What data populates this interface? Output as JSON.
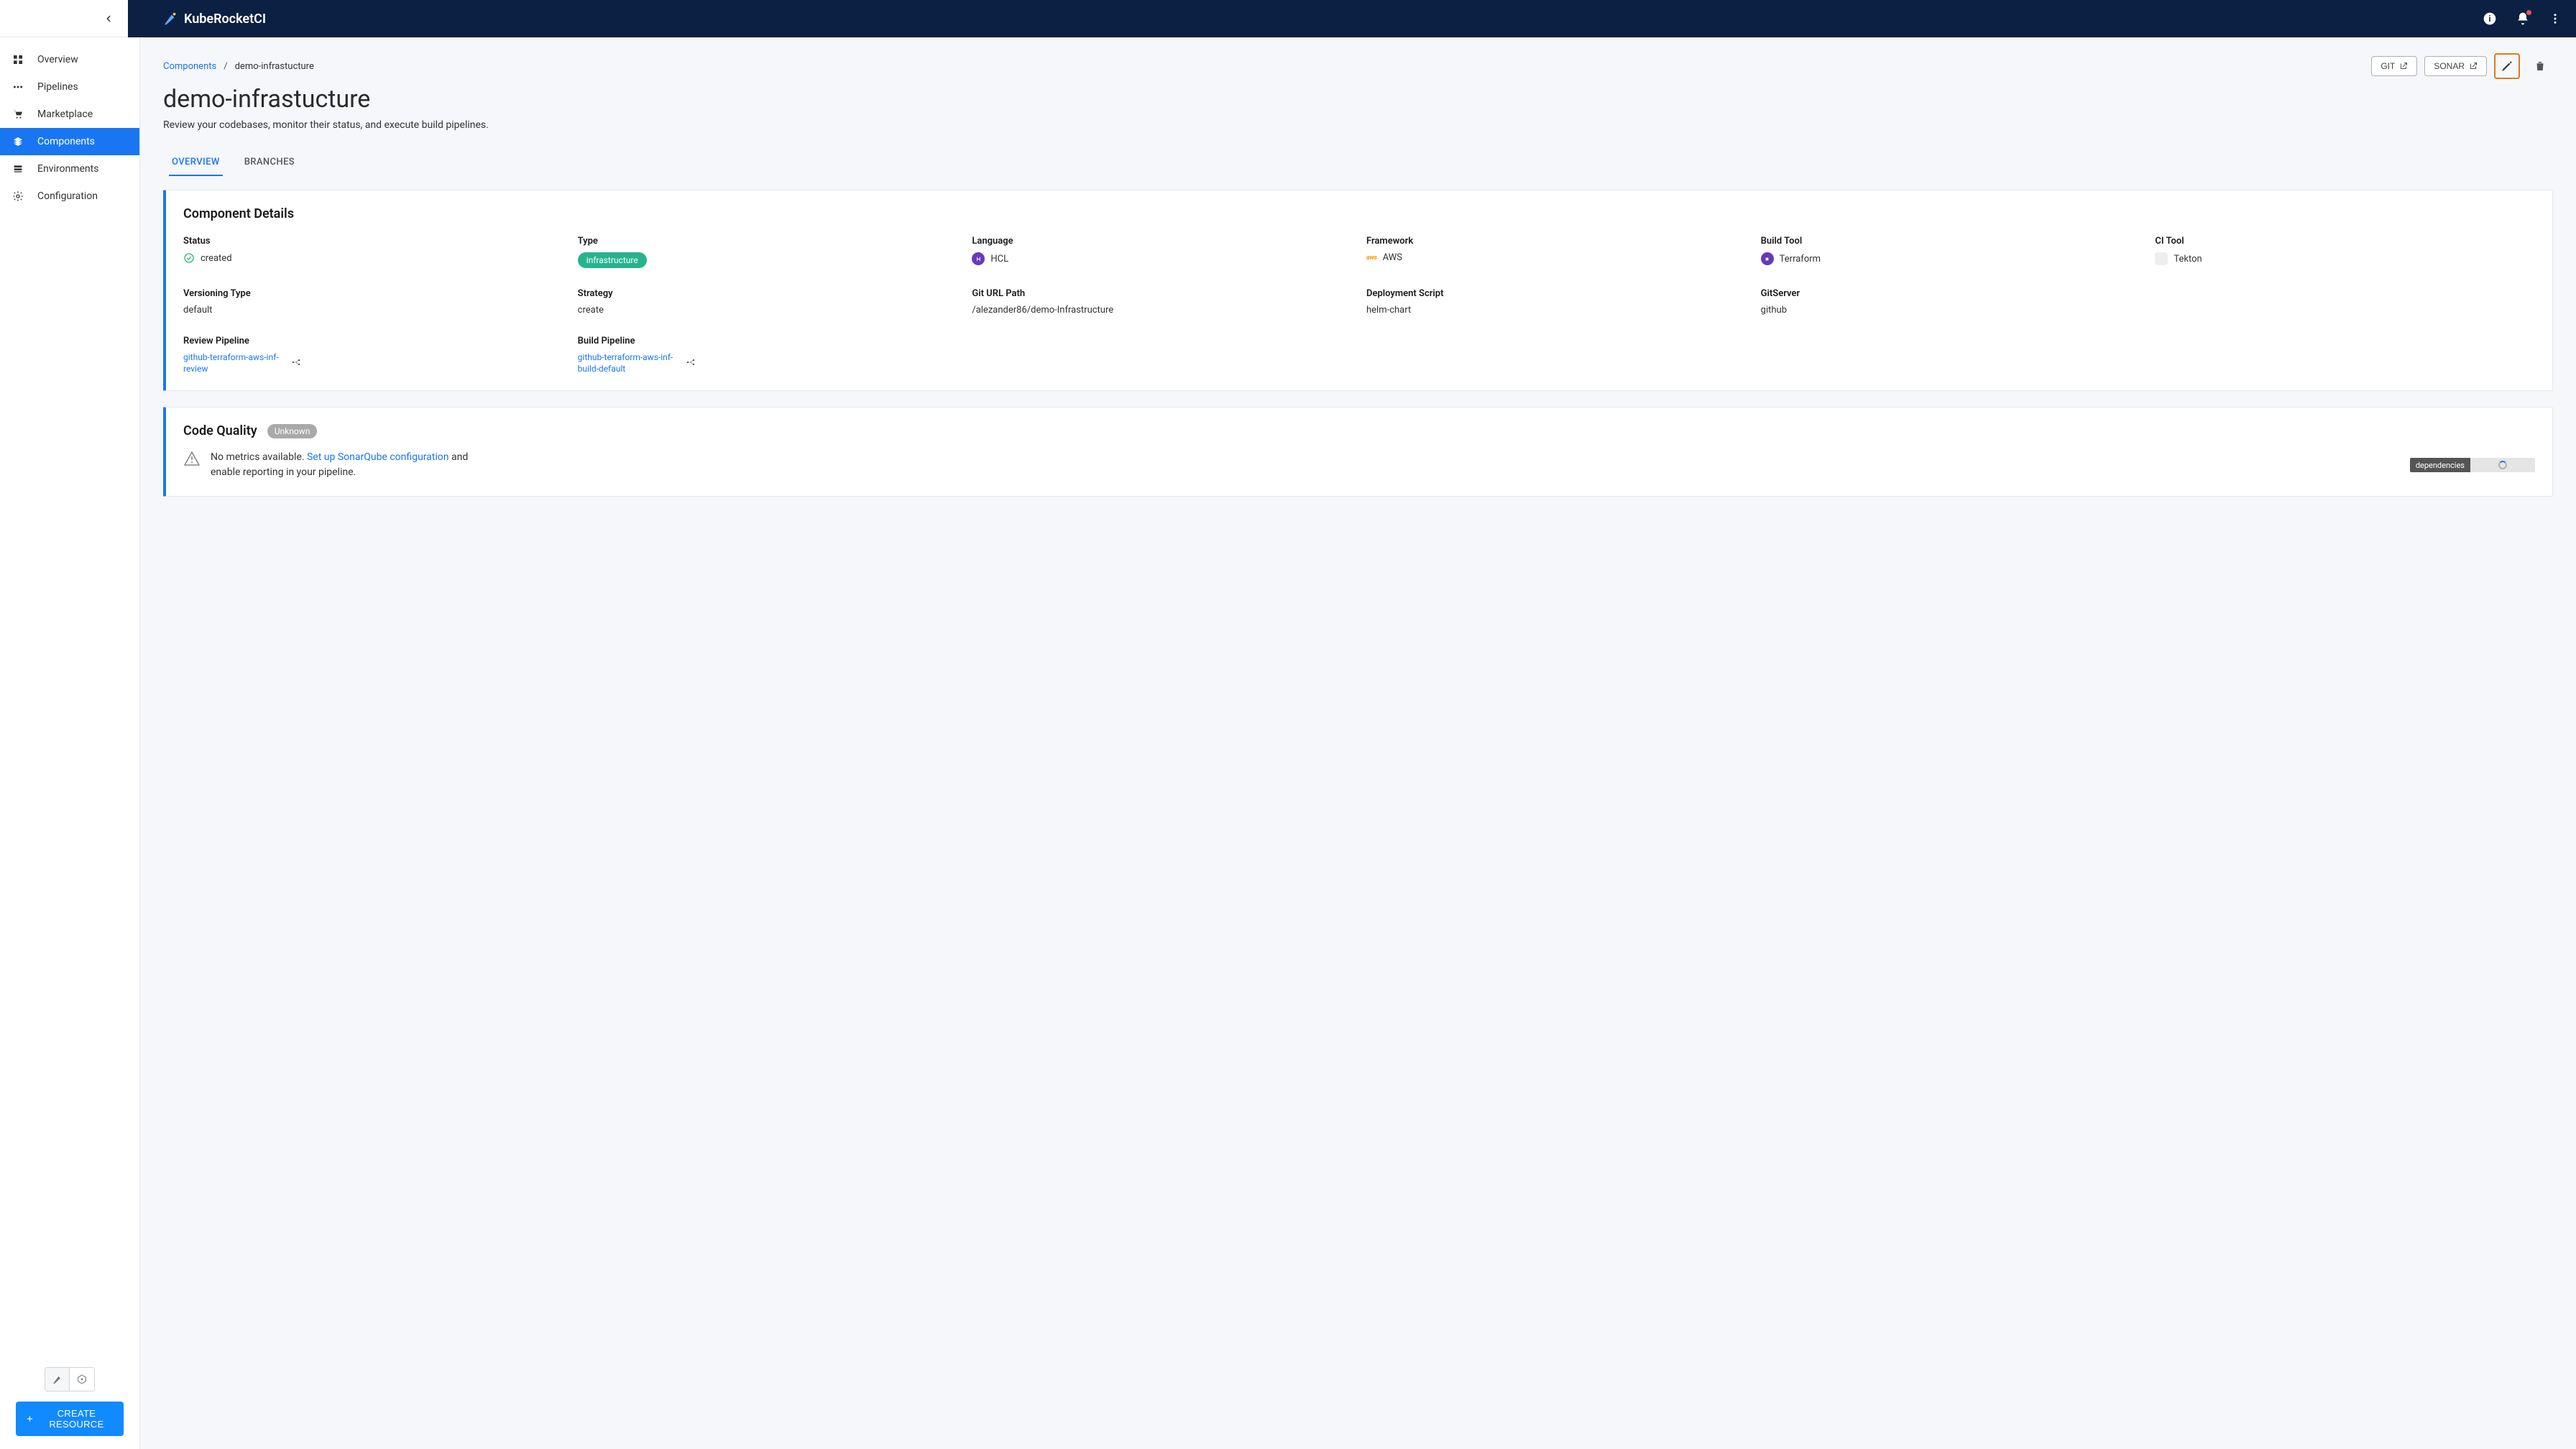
{
  "brand": {
    "name": "KubeRocketCI"
  },
  "sidebar": {
    "items": [
      {
        "label": "Overview"
      },
      {
        "label": "Pipelines"
      },
      {
        "label": "Marketplace"
      },
      {
        "label": "Components"
      },
      {
        "label": "Environments"
      },
      {
        "label": "Configuration"
      }
    ],
    "create_label": "CREATE RESOURCE"
  },
  "breadcrumb": {
    "root": "Components",
    "current": "demo-infrastucture"
  },
  "actions": {
    "git": "GIT",
    "sonar": "SONAR"
  },
  "page": {
    "title": "demo-infrastucture",
    "desc": "Review your codebases, monitor their status, and execute build pipelines."
  },
  "tabs": [
    {
      "label": "OVERVIEW",
      "active": true
    },
    {
      "label": "BRANCHES"
    }
  ],
  "component_details": {
    "heading": "Component Details",
    "status_label": "Status",
    "status_value": "created",
    "type_label": "Type",
    "type_value": "infrastructure",
    "language_label": "Language",
    "language_value": "HCL",
    "framework_label": "Framework",
    "framework_value": "AWS",
    "build_tool_label": "Build Tool",
    "build_tool_value": "Terraform",
    "ci_tool_label": "CI Tool",
    "ci_tool_value": "Tekton",
    "versioning_type_label": "Versioning Type",
    "versioning_type_value": "default",
    "strategy_label": "Strategy",
    "strategy_value": "create",
    "git_url_label": "Git URL Path",
    "git_url_value": "/alezander86/demo-Infrastructure",
    "deploy_script_label": "Deployment Script",
    "deploy_script_value": "helm-chart",
    "git_server_label": "GitServer",
    "git_server_value": "github",
    "review_pipeline_label": "Review Pipeline",
    "review_pipeline_value": "github-terraform-aws-inf-review",
    "build_pipeline_label": "Build Pipeline",
    "build_pipeline_value": "github-terraform-aws-inf-build-default"
  },
  "code_quality": {
    "heading": "Code Quality",
    "badge": "Unknown",
    "msg_prefix": "No metrics available. ",
    "msg_link": "Set up SonarQube configuration",
    "msg_suffix": " and enable reporting in your pipeline.",
    "dep_label": "dependencies"
  }
}
